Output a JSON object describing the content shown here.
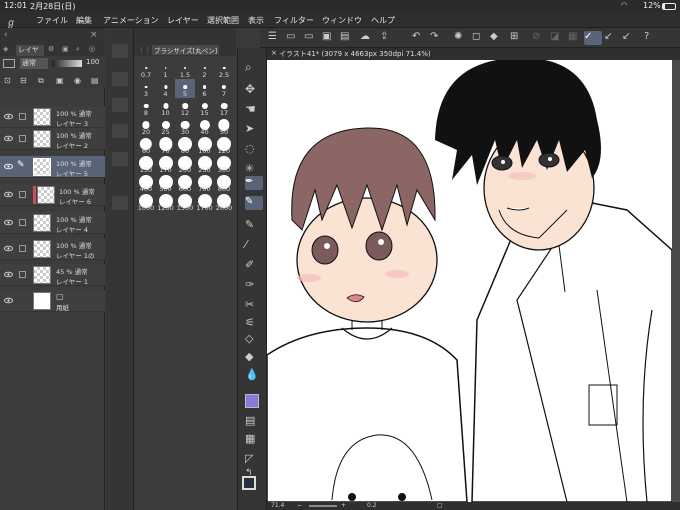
{
  "status": {
    "time": "12:01",
    "date": "2月28日(日)",
    "battery": "12%"
  },
  "menu": {
    "items": [
      "ファイル",
      "編集",
      "アニメーション",
      "レイヤー",
      "選択範囲",
      "表示",
      "フィルター",
      "ウィンドウ",
      "ヘルプ"
    ]
  },
  "layer_panel": {
    "tab_label": "レイヤー",
    "blend_mode": "通常",
    "opacity": "100",
    "layers": [
      {
        "opacity": "100 %",
        "mode": "通常",
        "name": "レイヤー 3"
      },
      {
        "opacity": "100 %",
        "mode": "通常",
        "name": "レイヤー 2"
      },
      {
        "opacity": "100 %",
        "mode": "通常",
        "name": "レイヤー 5"
      },
      {
        "opacity": "100 %",
        "mode": "通常",
        "name": "レイヤー 6"
      },
      {
        "opacity": "100 %",
        "mode": "通常",
        "name": "レイヤー 4"
      },
      {
        "opacity": "100 %",
        "mode": "通常",
        "name": "レイヤー 1の"
      },
      {
        "opacity": "45 %",
        "mode": "通常",
        "name": "レイヤー 1"
      },
      {
        "opacity": "",
        "mode": "",
        "name": "用紙"
      }
    ]
  },
  "brush_panel": {
    "title": "ブラシサイズ[丸ペン]",
    "sizes": [
      "0.7",
      "1",
      "1.5",
      "2",
      "2.5",
      "3",
      "4",
      "5",
      "6",
      "7",
      "8",
      "10",
      "12",
      "15",
      "17",
      "20",
      "25",
      "30",
      "40",
      "50",
      "60",
      "70",
      "80",
      "100",
      "120",
      "150",
      "170",
      "200",
      "250",
      "300",
      "400",
      "500",
      "600",
      "700",
      "800",
      "1000",
      "1200",
      "1500",
      "1700",
      "2000"
    ],
    "selected": "5"
  },
  "document": {
    "tab": "イラスト41* (3079 x 4663px 350dpi 71.4%)",
    "zoom": "71.4",
    "rotate": "0.2"
  },
  "colors": {
    "accent": "#5a6478",
    "panel": "#3c3c3c",
    "main_color": "#2a2f3f",
    "sub_color": "#ffffff"
  }
}
